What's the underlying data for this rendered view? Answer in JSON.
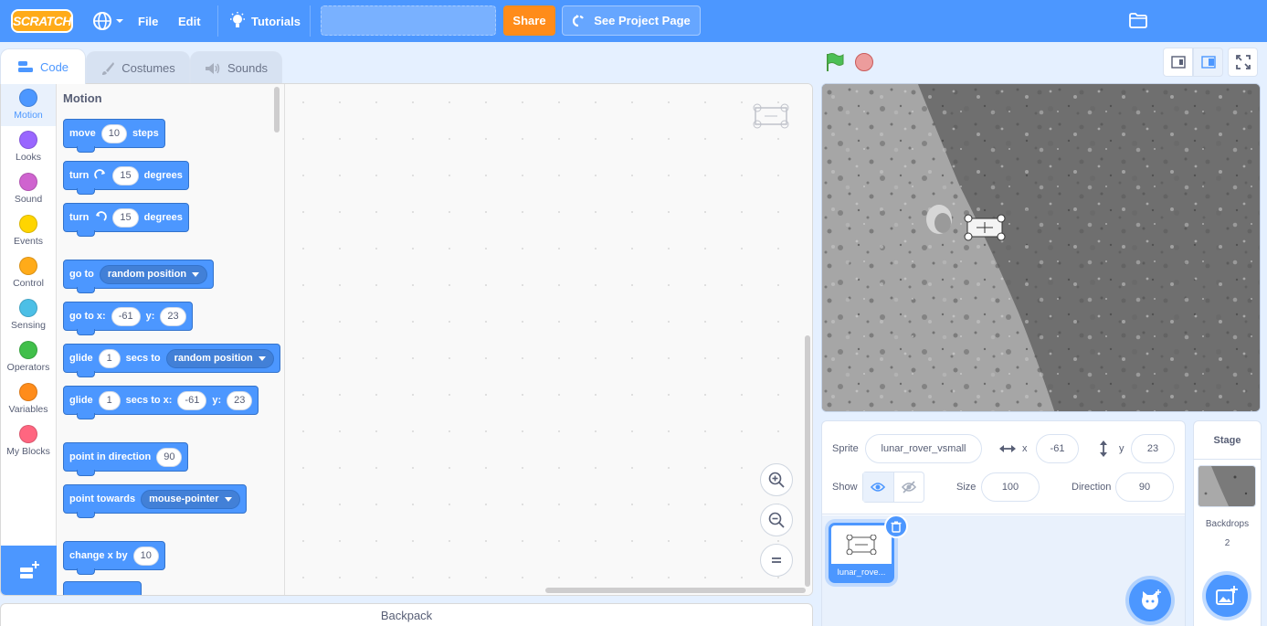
{
  "menubar": {
    "logo": "SCRATCH",
    "file": "File",
    "edit": "Edit",
    "tutorials": "Tutorials",
    "project_title_value": "",
    "share": "Share",
    "see_project_page": "See Project Page"
  },
  "tabs": {
    "code": "Code",
    "costumes": "Costumes",
    "sounds": "Sounds"
  },
  "categories": [
    {
      "label": "Motion",
      "color": "#4c97ff"
    },
    {
      "label": "Looks",
      "color": "#9966ff"
    },
    {
      "label": "Sound",
      "color": "#cf63cf"
    },
    {
      "label": "Events",
      "color": "#ffd500"
    },
    {
      "label": "Control",
      "color": "#ffab19"
    },
    {
      "label": "Sensing",
      "color": "#4cbfe6"
    },
    {
      "label": "Operators",
      "color": "#40bf4a"
    },
    {
      "label": "Variables",
      "color": "#ff8c1a"
    },
    {
      "label": "My Blocks",
      "color": "#ff6680"
    }
  ],
  "flyout": {
    "section": "Motion",
    "move": {
      "t1": "move",
      "v": "10",
      "t2": "steps"
    },
    "turn_right": {
      "t1": "turn",
      "v": "15",
      "t2": "degrees"
    },
    "turn_left": {
      "t1": "turn",
      "v": "15",
      "t2": "degrees"
    },
    "goto": {
      "t1": "go to",
      "opt": "random position"
    },
    "gotoxy": {
      "t1": "go to x:",
      "x": "-61",
      "t2": "y:",
      "y": "23"
    },
    "glide_to": {
      "t1": "glide",
      "v": "1",
      "t2": "secs to",
      "opt": "random position"
    },
    "glide_xy": {
      "t1": "glide",
      "v": "1",
      "t2": "secs to x:",
      "x": "-61",
      "t3": "y:",
      "y": "23"
    },
    "point_dir": {
      "t1": "point in direction",
      "v": "90"
    },
    "point_towards": {
      "t1": "point towards",
      "opt": "mouse-pointer"
    },
    "change_x": {
      "t1": "change x by",
      "v": "10"
    }
  },
  "backpack": "Backpack",
  "sprite_info": {
    "sprite_label": "Sprite",
    "sprite_name": "lunar_rover_vsmall",
    "x_label": "x",
    "x_value": "-61",
    "y_label": "y",
    "y_value": "23",
    "show_label": "Show",
    "size_label": "Size",
    "size_value": "100",
    "direction_label": "Direction",
    "direction_value": "90"
  },
  "sprites": [
    {
      "name": "lunar_rove..."
    }
  ],
  "stage_selector": {
    "title": "Stage",
    "backdrops_label": "Backdrops",
    "backdrops_count": "2"
  },
  "colors": {
    "accent": "#4c97ff",
    "share": "#ff8c1a",
    "menubar": "#4c97ff"
  }
}
